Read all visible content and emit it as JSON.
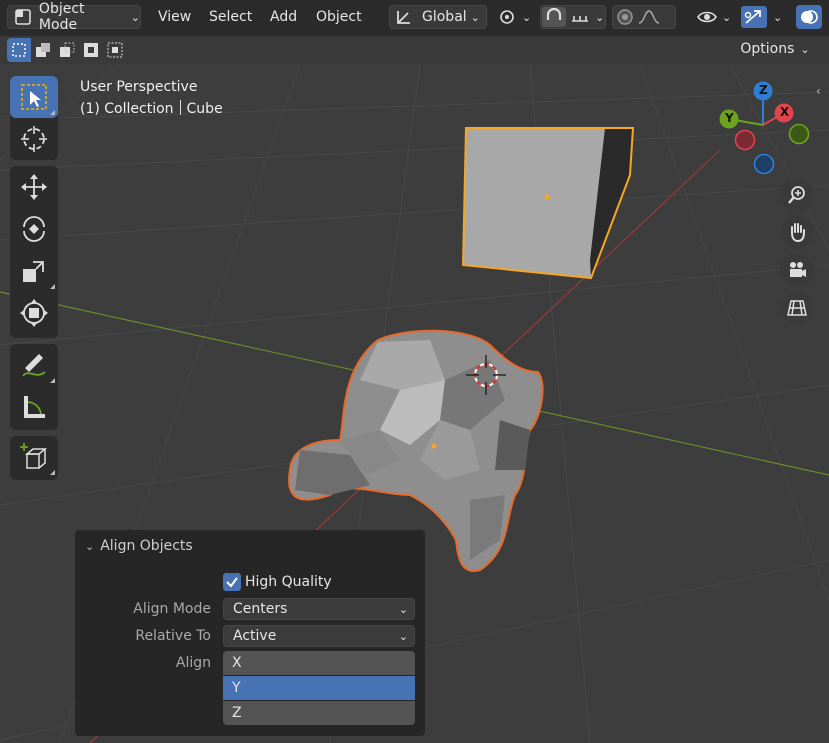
{
  "header": {
    "mode_label": "Object Mode",
    "menu": [
      "View",
      "Select",
      "Add",
      "Object"
    ],
    "transform_orientation": "Global",
    "options_label": "Options"
  },
  "overlay": {
    "view_name": "User Perspective",
    "collection": "(1) Collection",
    "active_object": "Cube"
  },
  "gizmo": {
    "axis_z": "Z",
    "axis_y": "Y",
    "axis_x": "X"
  },
  "panel": {
    "title": "Align Objects",
    "high_quality_label": "High Quality",
    "high_quality_checked": true,
    "align_mode_label": "Align Mode",
    "align_mode_value": "Centers",
    "relative_to_label": "Relative To",
    "relative_to_value": "Active",
    "align_label": "Align",
    "axes": [
      "X",
      "Y",
      "Z"
    ],
    "axis_selected": "Y"
  },
  "colors": {
    "selection_orange": "#f5a623",
    "active_blue": "#4772b3",
    "axis_x": "#e0444d",
    "axis_y": "#6ea31f",
    "axis_z": "#2d7ed6"
  }
}
